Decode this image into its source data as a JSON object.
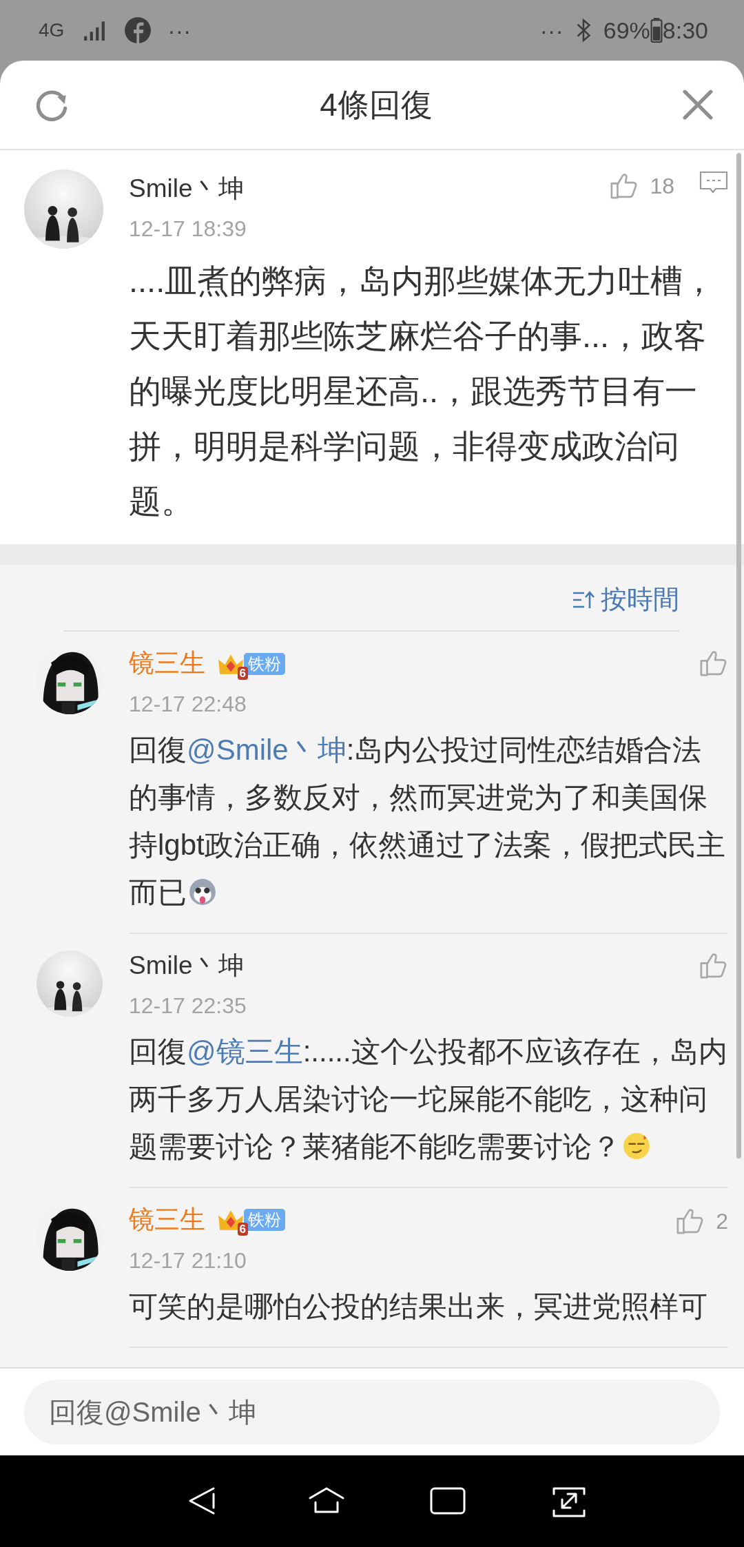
{
  "status_bar": {
    "network": "4G",
    "left_more": "···",
    "right_more": "···",
    "battery": "69%",
    "time": "8:30"
  },
  "header": {
    "title": "4條回復"
  },
  "main_comment": {
    "user": "Smile丶坤",
    "time": "12-17 18:39",
    "likes": "18",
    "text": "....皿煮的弊病，岛内那些媒体无力吐槽，天天盯着那些陈芝麻烂谷子的事...，政客的曝光度比明星还高..，跟选秀节目有一拼，明明是科学问题，非得变成政治问题。"
  },
  "sort": {
    "label": "按時間"
  },
  "replies": [
    {
      "user": "镜三生",
      "vip": true,
      "badge": "铁粉",
      "badge_level": "6",
      "time": "12-17 22:48",
      "reply_prefix": "回復",
      "mention": "@Smile丶坤",
      "text": ":岛内公投过同性恋结婚合法的事情，多数反对，然而冥进党为了和美国保持lgbt政治正确，依然通过了法案，假把式民主而已",
      "emoji": {
        "kind": "dog"
      }
    },
    {
      "user": "Smile丶坤",
      "vip": false,
      "time": "12-17 22:35",
      "reply_prefix": "回復",
      "mention": "@镜三生",
      "text": ":.....这个公投都不应该存在，岛内两千多万人居染讨论一坨屎能不能吃，这种问题需要讨论？莱猪能不能吃需要讨论？",
      "emoji": {
        "kind": "smirk"
      }
    },
    {
      "user": "镜三生",
      "vip": true,
      "badge": "铁粉",
      "badge_level": "6",
      "time": "12-17 21:10",
      "likes": "2",
      "text": "可笑的是哪怕公投的结果出来，冥进党照样可"
    }
  ],
  "input": {
    "placeholder": "回復@Smile丶坤"
  }
}
